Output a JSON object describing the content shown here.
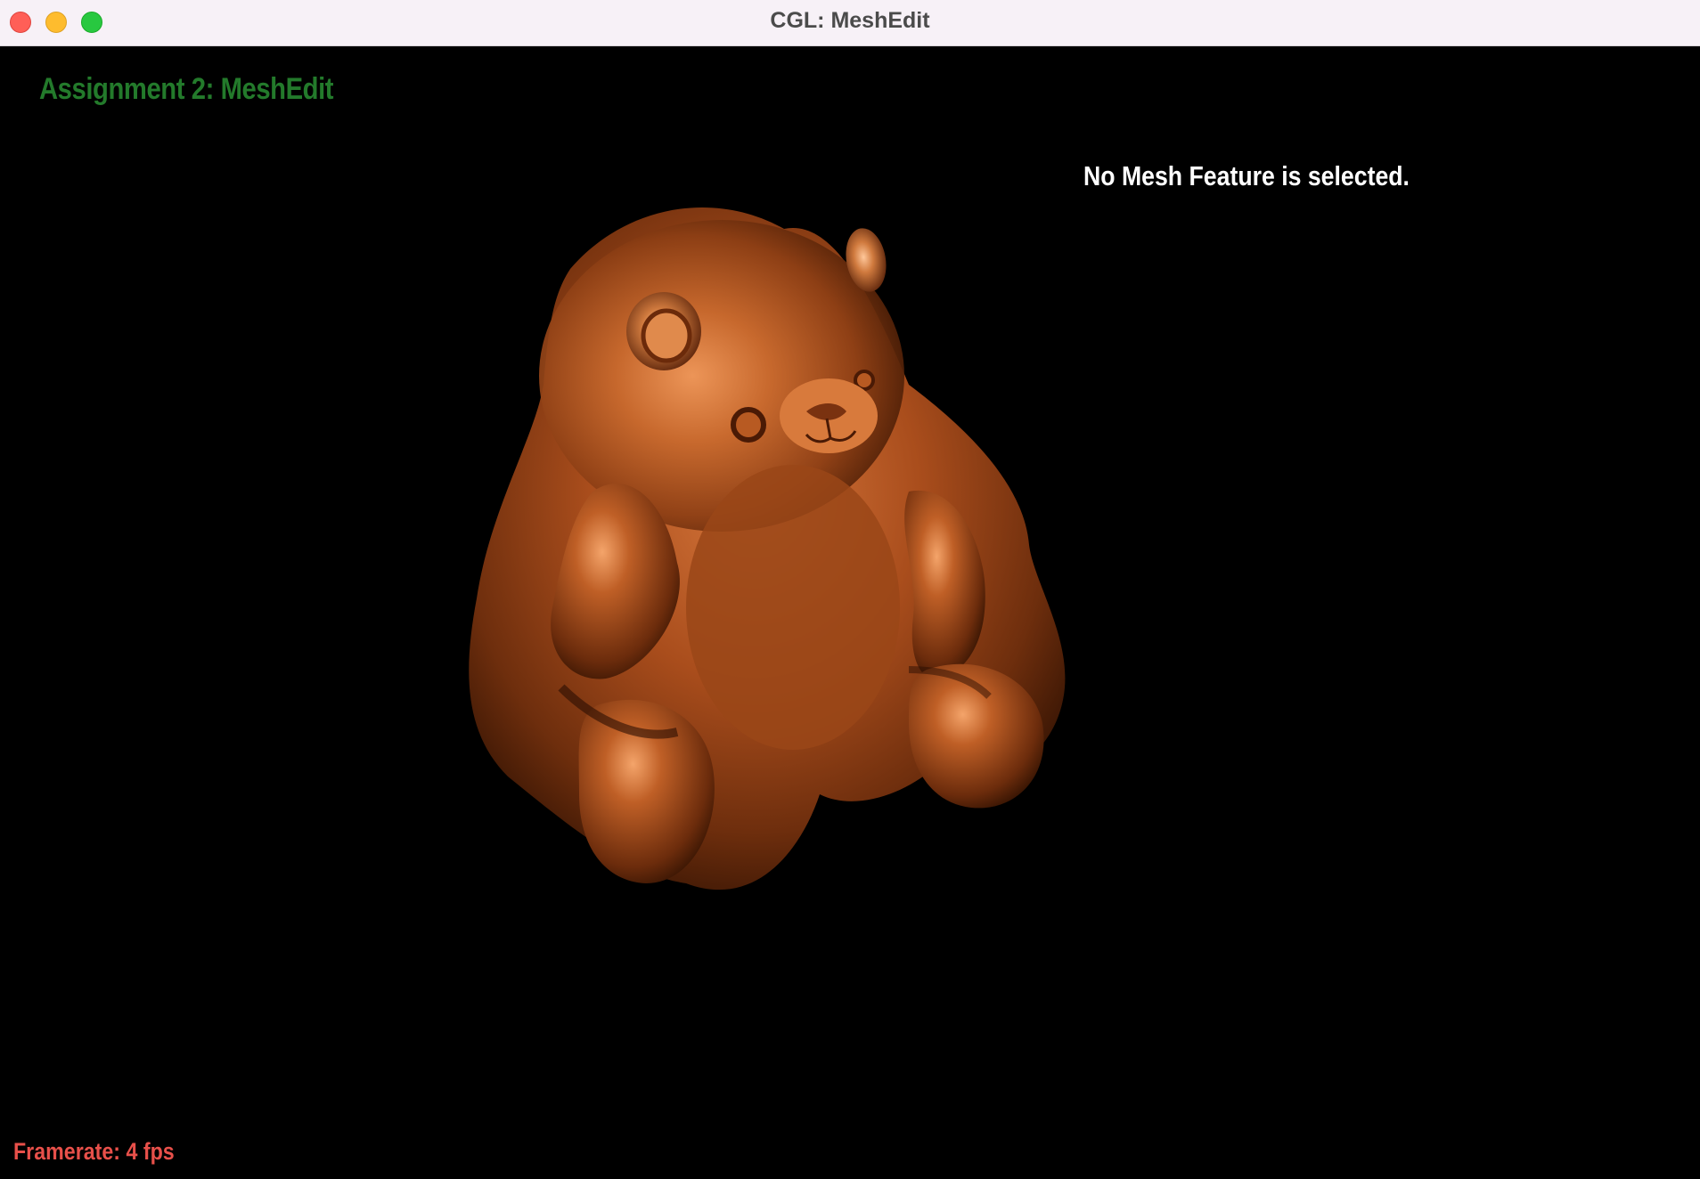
{
  "window": {
    "title": "CGL: MeshEdit",
    "buttons": [
      "close",
      "minimize",
      "zoom"
    ]
  },
  "viewport": {
    "heading": "Assignment 2: MeshEdit",
    "selection_status": "No Mesh Feature is selected.",
    "framerate": "Framerate: 4 fps",
    "mesh": {
      "icon": "teddy-bear-mesh",
      "material_color": "#b2531f"
    }
  },
  "colors": {
    "background": "#000000",
    "heading": "#237a2b",
    "status_text": "#ffffff",
    "framerate_text": "#e8504a",
    "titlebar": "#f7f1f7"
  }
}
